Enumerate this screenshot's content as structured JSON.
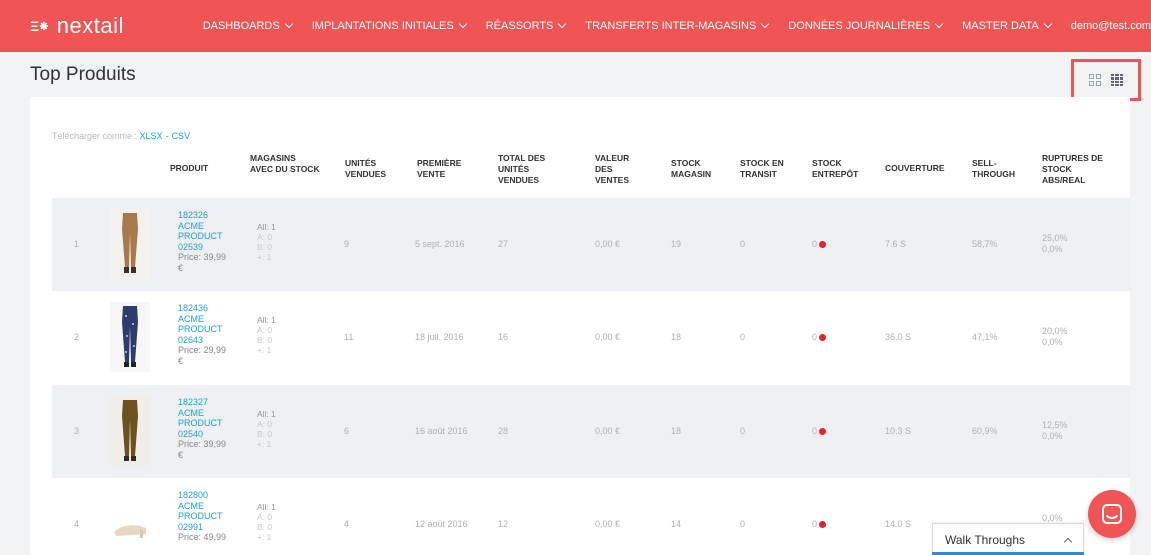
{
  "header": {
    "logo_mark": "Ξ⁕",
    "logo_text": "nextail",
    "nav": [
      {
        "label": "DASHBOARDS"
      },
      {
        "label": "IMPLANTATIONS INITIALES"
      },
      {
        "label": "RÉASSORTS"
      },
      {
        "label": "TRANSFERTS INTER-MAGASINS"
      },
      {
        "label": "DONNÉES JOURNALIÈRES"
      },
      {
        "label": "MASTER DATA"
      }
    ],
    "user": "demo@test.com"
  },
  "page": {
    "title": "Top Produits",
    "view_toggle": {
      "options": [
        "grid-view-icon",
        "list-view-icon"
      ],
      "active": "list-view-icon"
    }
  },
  "download": {
    "label": "Télécharger comme :",
    "xlsx": "XLSX",
    "sep": "-",
    "csv": "CSV"
  },
  "columns": [
    "PRODUIT",
    "MAGASINS AVEC DU STOCK",
    "UNITÉS VENDUES",
    "PREMIÈRE VENTE",
    "TOTAL DES UNITÉS VENDUES",
    "VALEUR DES VENTES",
    "STOCK MAGASIN",
    "STOCK EN TRANSIT",
    "STOCK ENTREPÔT",
    "COUVERTURE",
    "SELL-THROUGH",
    "RUPTURES DE STOCK ABS/REAL"
  ],
  "rows": [
    {
      "rank": "1",
      "p1": "182326",
      "p2": "ACME",
      "p3": "PRODUCT",
      "p4": "02539",
      "price1": "Price: 39,99",
      "price2": "€",
      "s_all": "All: 1",
      "s_a": "A: 0",
      "s_b": "B: 0",
      "s_c": "+: 1",
      "units": "9",
      "first_sale": "5 sept. 2016",
      "total": "27",
      "value": "0,00 €",
      "stock_store": "19",
      "transit": "0",
      "warehouse": "0",
      "cover": "7.6 S",
      "sell_through": "58,7%",
      "rupt_abs": "25,0%",
      "rupt_real": "0,0%",
      "thumb": "camel-trousers"
    },
    {
      "rank": "2",
      "p1": "182436",
      "p2": "ACME",
      "p3": "PRODUCT",
      "p4": "02643",
      "price1": "Price: 29,99",
      "price2": "€",
      "s_all": "All: 1",
      "s_a": "A: 0",
      "s_b": "B: 0",
      "s_c": "+: 1",
      "units": "11",
      "first_sale": "18 juil. 2016",
      "total": "16",
      "value": "0,00 €",
      "stock_store": "18",
      "transit": "0",
      "warehouse": "0",
      "cover": "36.0 S",
      "sell_through": "47,1%",
      "rupt_abs": "20,0%",
      "rupt_real": "0,0%",
      "thumb": "navy-print-trousers"
    },
    {
      "rank": "3",
      "p1": "182327",
      "p2": "ACME",
      "p3": "PRODUCT",
      "p4": "02540",
      "price1": "Price: 39,99",
      "price2": "€",
      "s_all": "All: 1",
      "s_a": "A: 0",
      "s_b": "B: 0",
      "s_c": "+: 1",
      "units": "6",
      "first_sale": "16 août 2016",
      "total": "28",
      "value": "0,00 €",
      "stock_store": "18",
      "transit": "0",
      "warehouse": "0",
      "cover": "10.3 S",
      "sell_through": "60,9%",
      "rupt_abs": "12,5%",
      "rupt_real": "0,0%",
      "thumb": "olive-trousers"
    },
    {
      "rank": "4",
      "p1": "182800",
      "p2": "ACME",
      "p3": "PRODUCT",
      "p4": "02991",
      "price1": "Price: 49,99",
      "price2": "",
      "s_all": "All: 1",
      "s_a": "A: 0",
      "s_b": "B: 0",
      "s_c": "+: 1",
      "units": "4",
      "first_sale": "12 août 2016",
      "total": "12",
      "value": "0,00 €",
      "stock_store": "14",
      "transit": "0",
      "warehouse": "0",
      "cover": "14.0 S",
      "sell_through": "",
      "rupt_abs": "0,0%",
      "rupt_real": "",
      "thumb": "beige-shoe"
    }
  ],
  "walkthrough": {
    "label": "Walk Throughs"
  },
  "colors": {
    "brand": "#f05454",
    "link": "#1ea0dc",
    "alert_dot": "#e0242b",
    "row_shade": "#eef0f3"
  }
}
